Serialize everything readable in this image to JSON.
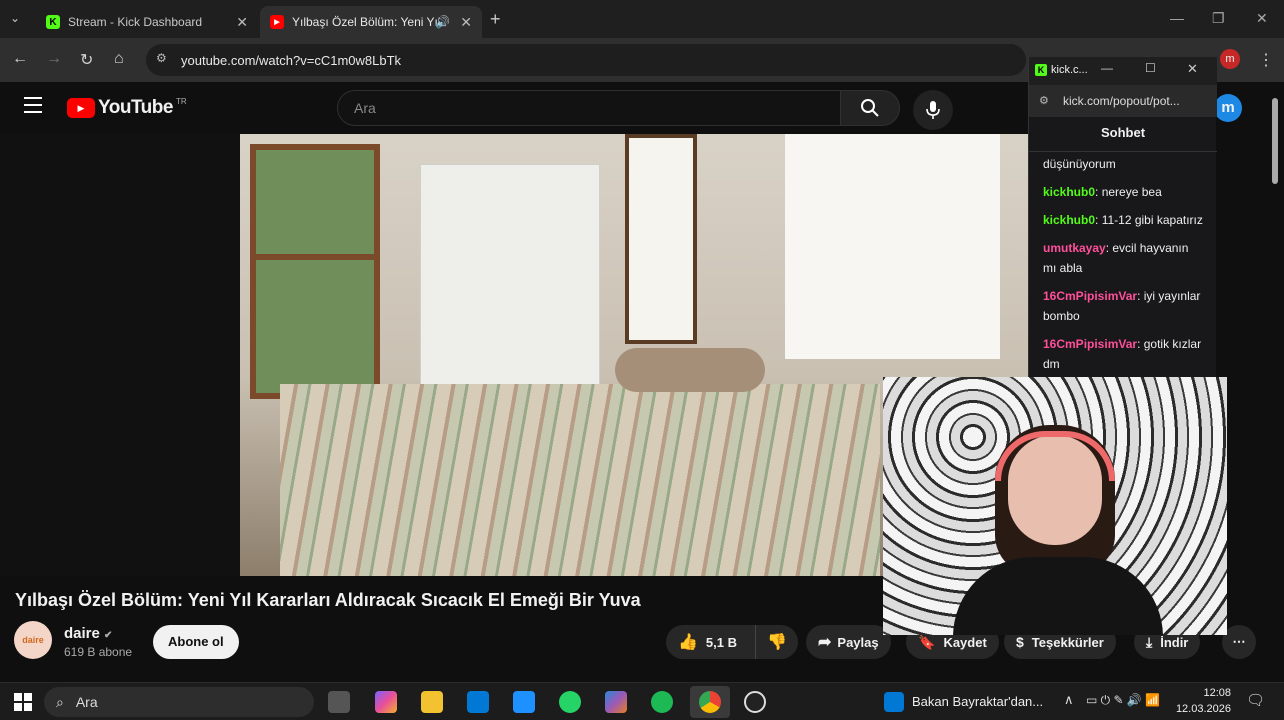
{
  "browser": {
    "tabs": [
      {
        "title": "Stream - Kick Dashboard",
        "favicon": "kick-icon"
      },
      {
        "title": "Yılbaşı Özel Bölüm: Yeni Yıl",
        "favicon": "youtube-icon"
      }
    ],
    "url": "youtube.com/watch?v=cC1m0w8LbTk",
    "profile_initial": "m"
  },
  "youtube": {
    "logo_text": "YouTube",
    "region": "TR",
    "search_placeholder": "Ara",
    "avatar_initial": "m",
    "video_title": "Yılbaşı Özel Bölüm: Yeni Yıl Kararları Aldıracak Sıcacık El Emeği Bir Yuva",
    "channel": {
      "name": "daire",
      "subscribers": "619 B abone",
      "avatar_text": "daire"
    },
    "subscribe_label": "Abone ol",
    "actions": {
      "likes": "5,1 B",
      "share": "Paylaş",
      "save": "Kaydet",
      "thanks": "Teşekkürler",
      "download": "İndir"
    }
  },
  "kick_popup": {
    "window_title": "kick.c...",
    "url": "kick.com/popout/pot...",
    "chat_header": "Sohbet",
    "messages": [
      {
        "user": "",
        "text": "düşünüyorum",
        "color": "#efeff1"
      },
      {
        "user": "kickhub0",
        "text": "nereye bea",
        "color": "#53fc18"
      },
      {
        "user": "kickhub0",
        "text": "11-12 gibi kapatırız",
        "color": "#53fc18"
      },
      {
        "user": "umutkayay",
        "text": "evcil hayvanın mı abla",
        "color": "#ff4f9a"
      },
      {
        "user": "16CmPipisimVar",
        "text": "iyi yayınlar bombo",
        "color": "#ff4f9a"
      },
      {
        "user": "16CmPipisimVar",
        "text": "gotik kızlar dm",
        "color": "#ff4f9a"
      }
    ]
  },
  "taskbar": {
    "search_label": "Ara",
    "news_text": "Bakan Bayraktar'dan...",
    "time": "12:08",
    "date": "12.03.2026"
  }
}
